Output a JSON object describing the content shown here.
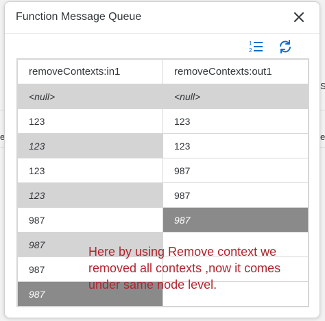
{
  "dialog": {
    "title": "Function Message Queue"
  },
  "toolbar": {
    "list_icon": "numbered-list-icon",
    "refresh_icon": "refresh-icon"
  },
  "table": {
    "columns": [
      "removeContexts:in1",
      "removeContexts:out1"
    ],
    "rows": [
      {
        "in": "<null>",
        "out": "<null>"
      },
      {
        "in": "123",
        "out": "123"
      },
      {
        "in": "123",
        "out": "123"
      },
      {
        "in": "123",
        "out": "987"
      },
      {
        "in": "123",
        "out": "987"
      },
      {
        "in": "987",
        "out": "987"
      },
      {
        "in": "987",
        "out": ""
      },
      {
        "in": "987",
        "out": ""
      },
      {
        "in": "987",
        "out": ""
      }
    ]
  },
  "annotation": {
    "text": "Here by using Remove context we removed all contexts ,now it comes under same node level."
  },
  "background": {
    "edge_right_1": "S",
    "edge_right_2": "e",
    "edge_left_1": "e"
  },
  "colors": {
    "annotation": "#b0252e",
    "accent": "#0a6ed1",
    "cell_grey": "#d4d4d4",
    "cell_dark": "#8a8a8a"
  }
}
